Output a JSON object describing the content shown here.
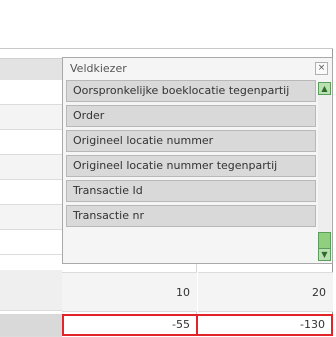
{
  "field_picker": {
    "title": "Veldkiezer",
    "close_label": "×",
    "items": [
      {
        "label": "Oorspronkelijke boeklocatie tegenpartij"
      },
      {
        "label": "Order"
      },
      {
        "label": "Origineel locatie nummer"
      },
      {
        "label": "Origineel locatie nummer tegenpartij"
      },
      {
        "label": "Transactie Id"
      },
      {
        "label": "Transactie nr"
      }
    ],
    "scroll_up_glyph": "▲",
    "scroll_down_glyph": "▼"
  },
  "grid": {
    "totals": [
      "10",
      "20"
    ],
    "values": [
      "-55",
      "-130"
    ]
  }
}
